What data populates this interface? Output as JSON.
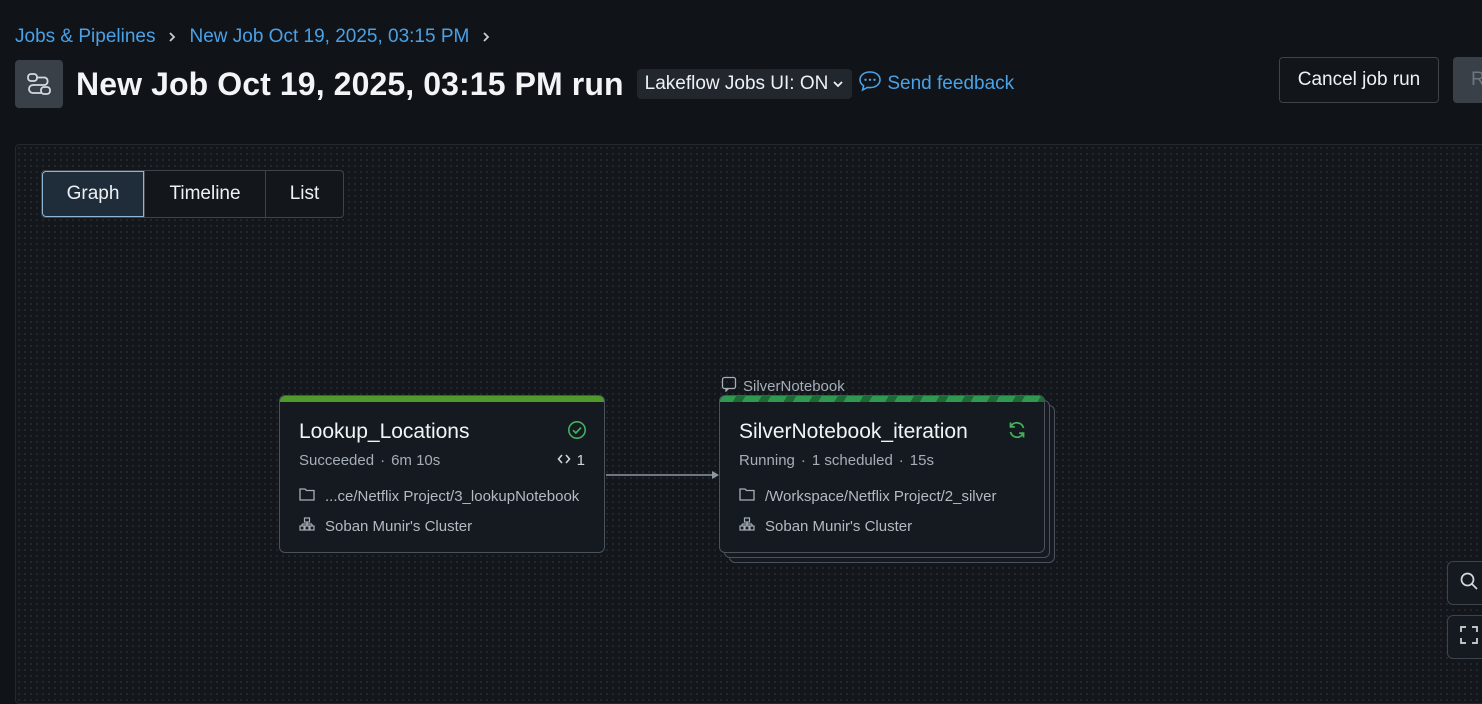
{
  "breadcrumb": {
    "items": [
      "Jobs & Pipelines",
      "New Job Oct 19, 2025, 03:15 PM"
    ]
  },
  "header": {
    "title": "New Job Oct 19, 2025, 03:15 PM run",
    "ui_toggle": "Lakeflow Jobs UI: ON",
    "feedback": "Send feedback",
    "cancel_button": "Cancel job run",
    "repair_button": "R"
  },
  "tabs": [
    "Graph",
    "Timeline",
    "List"
  ],
  "active_tab": "Graph",
  "graph": {
    "nodes": [
      {
        "name": "Lookup_Locations",
        "status": "Succeeded",
        "duration": "6m 10s",
        "iteration_count": "1",
        "path": "...ce/Netflix Project/3_lookupNotebook",
        "cluster": "Soban Munir's Cluster",
        "status_color": "#4f9a2a"
      },
      {
        "group_label": "SilverNotebook",
        "name": "SilverNotebook_iteration",
        "status": "Running",
        "scheduled": "1 scheduled",
        "duration": "15s",
        "path": "/Workspace/Netflix Project/2_silver",
        "cluster": "Soban Munir's Cluster",
        "status_color": "#2f9a4f"
      }
    ]
  },
  "icons": {
    "success": "check-circle-icon",
    "running": "refresh-icon",
    "folder": "folder-icon",
    "cluster": "cluster-icon"
  }
}
